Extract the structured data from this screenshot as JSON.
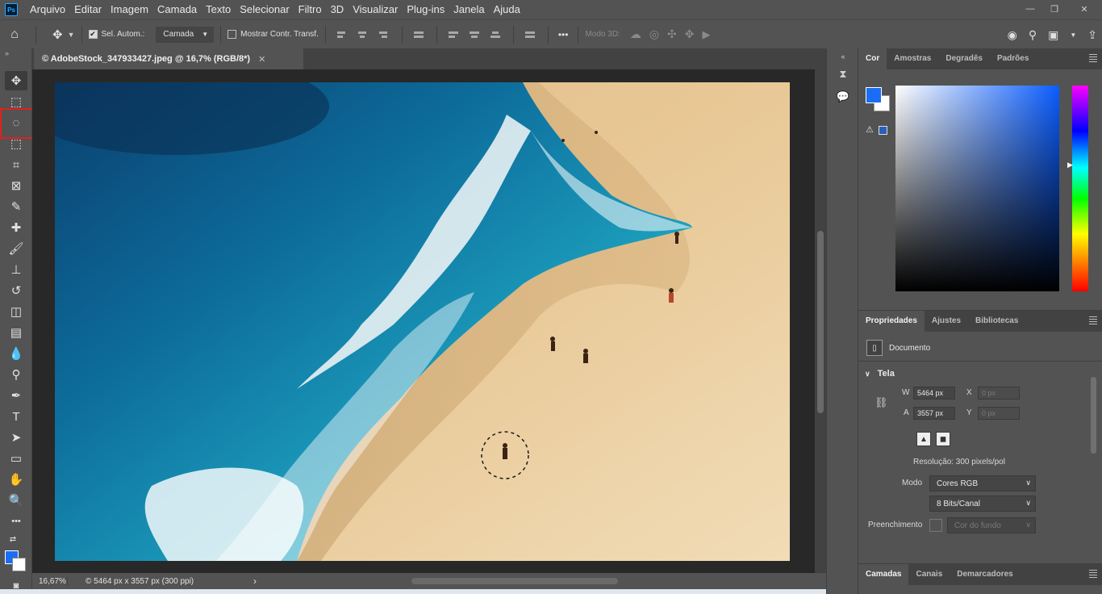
{
  "app": {
    "logo": "Ps"
  },
  "menu": [
    "Arquivo",
    "Editar",
    "Imagem",
    "Camada",
    "Texto",
    "Selecionar",
    "Filtro",
    "3D",
    "Visualizar",
    "Plug-ins",
    "Janela",
    "Ajuda"
  ],
  "window_controls": {
    "minimize": "—",
    "restore": "❐",
    "close": "✕"
  },
  "options": {
    "auto_select_label": "Sel. Autom.:",
    "auto_select_checked": true,
    "auto_select_target": "Camada",
    "show_transform_label": "Mostrar Contr. Transf.",
    "show_transform_checked": false,
    "more": "•••",
    "mode3d_label": "Modo 3D:"
  },
  "toolbar": {
    "collapse": "»",
    "tools": [
      {
        "name": "move-tool",
        "glyph": "✥"
      },
      {
        "name": "marquee-tool",
        "glyph": "⬚"
      },
      {
        "name": "lasso-tool",
        "glyph": "◌"
      },
      {
        "name": "object-select-tool",
        "glyph": "⬚"
      },
      {
        "name": "crop-tool",
        "glyph": "⌗"
      },
      {
        "name": "frame-tool",
        "glyph": "⊠"
      },
      {
        "name": "eyedropper-tool",
        "glyph": "✎"
      },
      {
        "name": "healing-brush-tool",
        "glyph": "✚"
      },
      {
        "name": "brush-tool",
        "glyph": "🖌"
      },
      {
        "name": "clone-stamp-tool",
        "glyph": "⊥"
      },
      {
        "name": "history-brush-tool",
        "glyph": "↺"
      },
      {
        "name": "eraser-tool",
        "glyph": "◫"
      },
      {
        "name": "gradient-tool",
        "glyph": "▤"
      },
      {
        "name": "blur-tool",
        "glyph": "💧"
      },
      {
        "name": "dodge-tool",
        "glyph": "⚲"
      },
      {
        "name": "pen-tool",
        "glyph": "✒"
      },
      {
        "name": "type-tool",
        "glyph": "T"
      },
      {
        "name": "path-select-tool",
        "glyph": "➤"
      },
      {
        "name": "rectangle-tool",
        "glyph": "▭"
      },
      {
        "name": "hand-tool",
        "glyph": "✋"
      },
      {
        "name": "zoom-tool",
        "glyph": "🔍"
      },
      {
        "name": "edit-toolbar",
        "glyph": "•••"
      }
    ]
  },
  "document": {
    "tab_title": "© AdobeStock_347933427.jpeg @ 16,7% (RGB/8*)",
    "close": "✕"
  },
  "status": {
    "zoom": "16,67%",
    "doc_info": "© 5464 px x 3557 px (300 ppi)",
    "arrow": "›"
  },
  "color_panel": {
    "tabs": [
      "Cor",
      "Amostras",
      "Degradês",
      "Padrões"
    ],
    "active_tab": "Cor",
    "foreground": "#1a6ef5",
    "background": "#ffffff",
    "warning_icon": "⚠"
  },
  "properties_panel": {
    "tabs": [
      "Propriedades",
      "Ajustes",
      "Bibliotecas"
    ],
    "active_tab": "Propriedades",
    "doc_label": "Documento",
    "section": "Tela",
    "w_label": "W",
    "w_value": "5464 px",
    "h_label": "A",
    "h_value": "3557 px",
    "x_label": "X",
    "x_placeholder": "0 px",
    "y_label": "Y",
    "y_placeholder": "0 px",
    "resolution": "Resolução: 300 pixels/pol",
    "mode_label": "Modo",
    "mode_value": "Cores RGB",
    "bits_value": "8 Bits/Canal",
    "fill_label": "Preenchimento",
    "fill_value": "Cor do fundo"
  },
  "layers_panel": {
    "tabs": [
      "Camadas",
      "Canais",
      "Demarcadores"
    ],
    "active_tab": "Camadas"
  }
}
